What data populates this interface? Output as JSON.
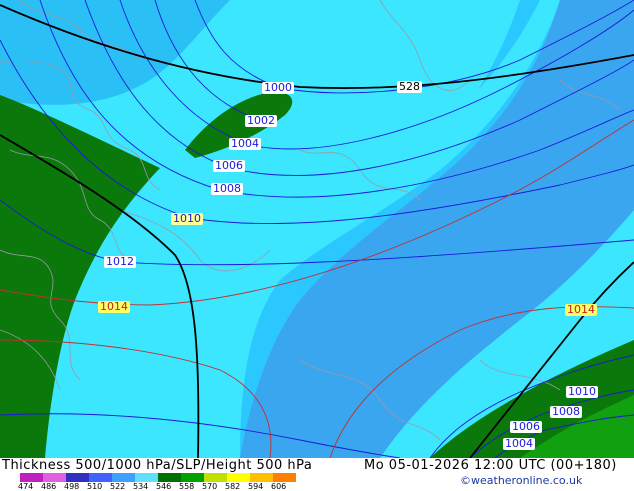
{
  "title": "Thickness 500/1000 hPa/SLP/Height 500 hPa",
  "datetime": "Mo 05-01-2026 12:00 UTC (00+180)",
  "credit": "©weatheronline.co.uk",
  "legend": {
    "ticks": [
      "474",
      "486",
      "498",
      "510",
      "522",
      "534",
      "546",
      "558",
      "570",
      "582",
      "594",
      "606"
    ],
    "colors": [
      "#c020c0",
      "#e060e0",
      "#3030c0",
      "#4060ff",
      "#40a0ff",
      "#60e0ff",
      "#007000",
      "#00a000",
      "#c0e000",
      "#ffff00",
      "#ffc000",
      "#ff8000"
    ]
  },
  "isobar_labels": [
    "1000",
    "1002",
    "1004",
    "1006",
    "1008",
    "1010",
    "1012",
    "1014",
    "1014",
    "1010",
    "1008",
    "1006",
    "1004"
  ],
  "height_labels": [
    "528"
  ],
  "colors": {
    "dark_green": "#0a780a",
    "cyan_light": "#3ce6ff",
    "cyan_mid": "#2bc8ff",
    "blue_mid": "#3aa6f0",
    "isobar": "#1a1ad8",
    "isobar_warm": "#c03030",
    "coast": "#9a9aa8",
    "height": "#000000"
  }
}
